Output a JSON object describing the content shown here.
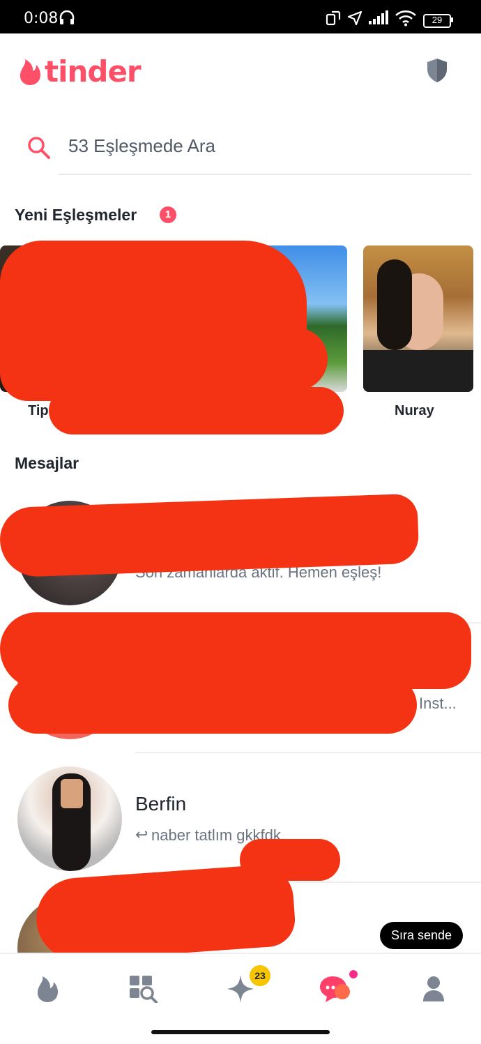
{
  "status_bar": {
    "time": "0:08",
    "battery": "29"
  },
  "app": {
    "logo_text": "tinder"
  },
  "search": {
    "placeholder": "53 Eşleşmede Ara"
  },
  "new_matches": {
    "title": "Yeni Eşleşmeler",
    "badge": "1",
    "cards": [
      {
        "name": "Tip"
      },
      {
        "name": ""
      },
      {
        "name": "Nuray"
      }
    ]
  },
  "messages": {
    "title": "Mesajlar",
    "items": [
      {
        "name": "",
        "preview": "Son zamanlarda aktif. Hemen eşleş!"
      },
      {
        "name": "",
        "preview": "Inst..."
      },
      {
        "name": "Berfin",
        "preview": "naber tatlım gkkfdk"
      },
      {
        "name": "",
        "preview": ""
      }
    ],
    "your_turn_label": "Sıra sende"
  },
  "bottom_nav": {
    "items": [
      "flame-icon",
      "explore-icon",
      "gold-sparkle-icon",
      "chat-icon",
      "profile-icon"
    ],
    "likes_badge": "23"
  },
  "colors": {
    "brand": "#fd5068",
    "nav_grey": "#7c8591",
    "gold": "#f6c400",
    "redaction": "#f33313"
  }
}
